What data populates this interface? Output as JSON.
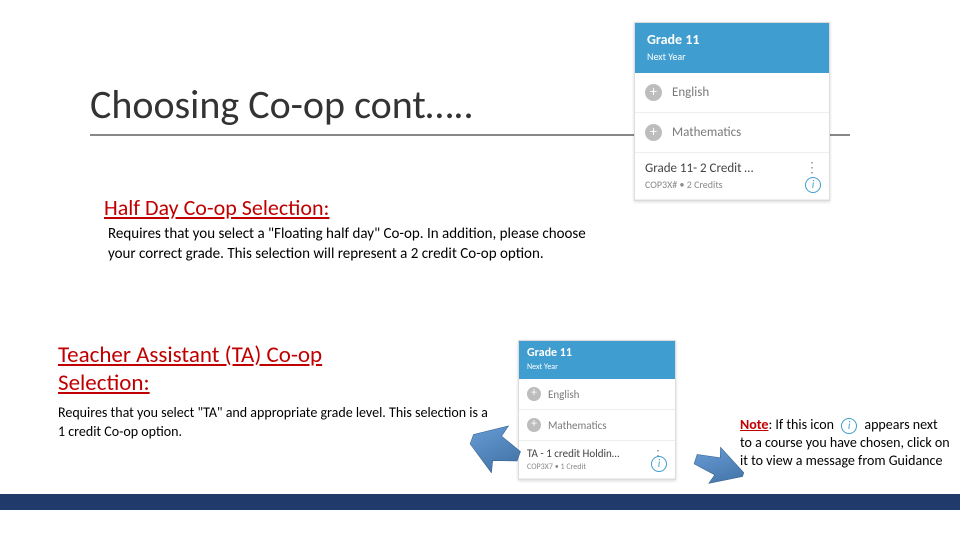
{
  "title": "Choosing Co-op cont…..",
  "halfday": {
    "heading": "Half Day Co-op Selection:",
    "body": "Requires that you select a \"Floating half day\" Co-op. In addition, please choose your correct grade. This selection will represent a 2 credit Co-op option."
  },
  "ta": {
    "heading": "Teacher Assistant (TA) Co-op Selection:",
    "body": "Requires that you select \"TA\" and appropriate grade level. This selection is a 1 credit Co-op option."
  },
  "note": {
    "label": "Note",
    "before_icon": ": If this icon",
    "after_icon": "appears next to a course you have chosen, click on it to view a message from Guidance"
  },
  "card_large": {
    "grade": "Grade 11",
    "next_year": "Next Year",
    "rows": [
      {
        "label": "English"
      },
      {
        "label": "Mathematics"
      }
    ],
    "selected": {
      "title": "Grade 11- 2 Credit …",
      "subtitle": "COP3X# • 2 Credits"
    }
  },
  "card_small": {
    "grade": "Grade 11",
    "next_year": "Next Year",
    "rows": [
      {
        "label": "English"
      },
      {
        "label": "Mathematics"
      }
    ],
    "selected": {
      "title": "TA - 1 credit Holdin…",
      "subtitle": "COP3X7 • 1 Credit"
    }
  },
  "icons": {
    "plus": "+",
    "info": "i",
    "dots": "⋮"
  }
}
